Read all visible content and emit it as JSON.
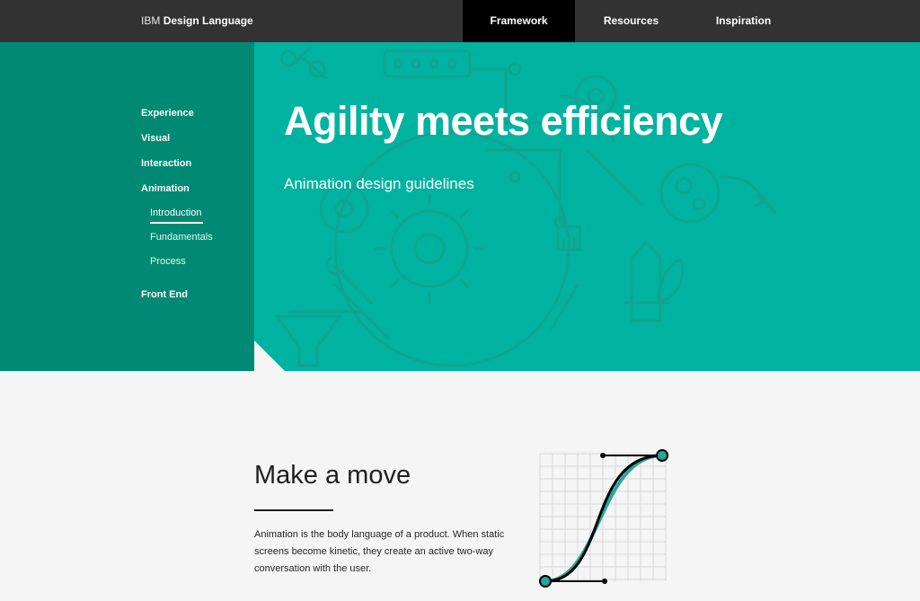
{
  "header": {
    "brand_prefix": "IBM",
    "brand_name": "Design Language",
    "nav": [
      {
        "label": "Framework",
        "active": true
      },
      {
        "label": "Resources",
        "active": false
      },
      {
        "label": "Inspiration",
        "active": false
      }
    ]
  },
  "sidebar": {
    "items": [
      {
        "label": "Experience"
      },
      {
        "label": "Visual"
      },
      {
        "label": "Interaction"
      },
      {
        "label": "Animation",
        "expanded": true
      },
      {
        "label": "Front End"
      }
    ],
    "sub_items": [
      {
        "label": "Introduction",
        "active": true
      },
      {
        "label": "Fundamentals"
      },
      {
        "label": "Process"
      }
    ]
  },
  "hero": {
    "title": "Agility meets efficiency",
    "subtitle": "Animation design guidelines",
    "illustration_icons": [
      "scissors-icon",
      "gear-icon",
      "wrench-icon",
      "funnel-icon",
      "rocket-icon",
      "leaf-icon"
    ]
  },
  "section": {
    "title": "Make a move",
    "body": "Animation is the body language of a product. When static screens become kinetic, they create an active two-way conversation with the user.",
    "figure_icon": "easing-curve-icon"
  },
  "colors": {
    "topbar": "#323232",
    "nav_active": "#000000",
    "hero": "#00b3a0",
    "sidebar": "#008a73",
    "accent": "#26a69a",
    "page": "#f5f5f5"
  }
}
